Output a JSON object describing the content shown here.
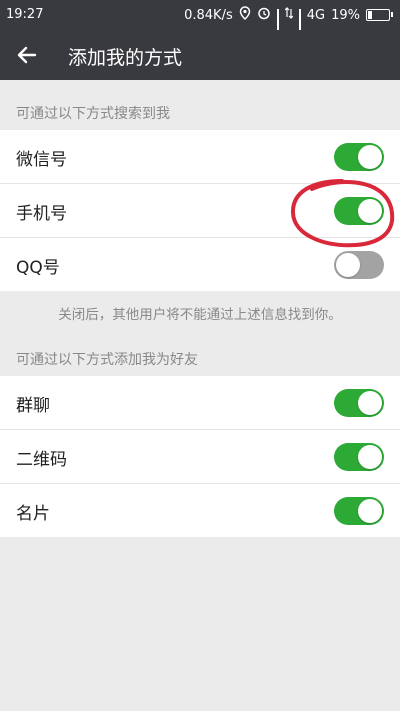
{
  "status_bar": {
    "time": "19:27",
    "speed": "0.84K/s",
    "network": "4G",
    "battery": "19%"
  },
  "app_bar": {
    "title": "添加我的方式",
    "back_icon": "arrow-left-icon"
  },
  "search_section": {
    "header": "可通过以下方式搜索到我",
    "items": [
      {
        "label": "微信号",
        "enabled": true
      },
      {
        "label": "手机号",
        "enabled": true
      },
      {
        "label": "QQ号",
        "enabled": false
      }
    ],
    "note": "关闭后，其他用户将不能通过上述信息找到你。"
  },
  "add_section": {
    "header": "可通过以下方式添加我为好友",
    "items": [
      {
        "label": "群聊",
        "enabled": true
      },
      {
        "label": "二维码",
        "enabled": true
      },
      {
        "label": "名片",
        "enabled": true
      }
    ]
  },
  "colors": {
    "toolbar": "#393a3f",
    "toggle_on": "#2daa36",
    "toggle_off": "#a3a3a3",
    "annotation": "#d8283a"
  }
}
